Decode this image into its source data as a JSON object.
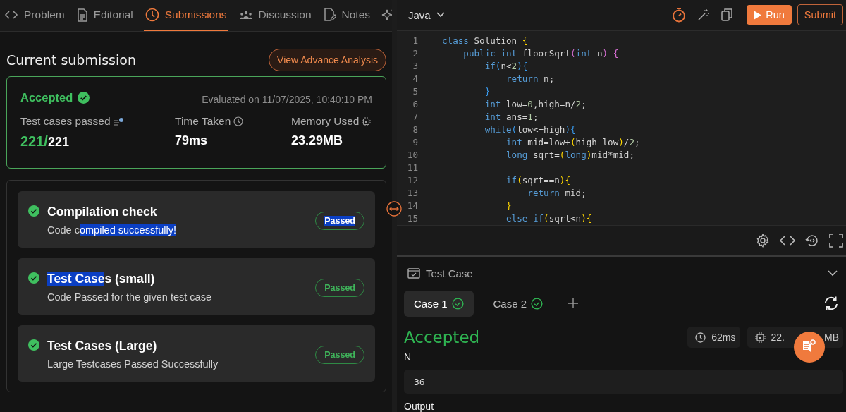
{
  "left_tabs": [
    {
      "label": "Problem",
      "selected": false
    },
    {
      "label": "Editorial",
      "selected": false
    },
    {
      "label": "Submissions",
      "selected": true
    },
    {
      "label": "Discussion",
      "selected": false
    },
    {
      "label": "Notes",
      "selected": false
    }
  ],
  "submission": {
    "heading": "Current submission",
    "analysis_button": "View Advance Analysis",
    "status": "Accepted",
    "evaluated": "Evaluated on 11/07/2025, 10:40:10 PM",
    "stats": [
      {
        "kind": "count",
        "label": "Test cases passed",
        "passed": "221/",
        "total": "221"
      },
      {
        "kind": "time",
        "label": "Time Taken",
        "value": "79ms"
      },
      {
        "kind": "memory",
        "label": "Memory Used",
        "value": "23.29MB"
      }
    ]
  },
  "checks": [
    {
      "passed": true,
      "title": [
        {
          "text": "Compilation check",
          "highlighted": false
        }
      ],
      "description": [
        {
          "text": "Code c",
          "highlighted": false
        },
        {
          "text": "ompiled successfully!",
          "highlighted": true
        }
      ],
      "badge": {
        "label": "Passed",
        "highlighted": true
      }
    },
    {
      "passed": true,
      "title": [
        {
          "text": "Test Case",
          "highlighted": true
        },
        {
          "text": "s (small)",
          "highlighted": false
        }
      ],
      "description": [
        {
          "text": "Code Passed for the given test case",
          "highlighted": false
        }
      ],
      "badge": {
        "label": "Passed",
        "highlighted": false
      }
    },
    {
      "passed": true,
      "title": [
        {
          "text": "Test Cases (Large)",
          "highlighted": false
        }
      ],
      "description": [
        {
          "text": "Large Testcases Passed Successfully",
          "highlighted": false
        }
      ],
      "badge": {
        "label": "Passed",
        "highlighted": false
      }
    }
  ],
  "editor": {
    "language": "Java",
    "run_button": "Run",
    "submit_button": "Submit",
    "lines": [
      {
        "number": "1",
        "tokens": [
          {
            "kind": "kw",
            "text": "class"
          },
          {
            "kind": "id",
            "text": " Solution "
          },
          {
            "kind": "br",
            "text": "{"
          }
        ]
      },
      {
        "number": "2",
        "tokens": [
          {
            "kind": "kw",
            "text": "    public int"
          },
          {
            "kind": "id",
            "text": " floorSqrt"
          },
          {
            "kind": "pa",
            "text": "("
          },
          {
            "kind": "kw",
            "text": "int"
          },
          {
            "kind": "id",
            "text": " n"
          },
          {
            "kind": "pa",
            "text": ") {"
          }
        ]
      },
      {
        "number": "3",
        "tokens": [
          {
            "kind": "kw",
            "text": "        if"
          },
          {
            "kind": "bl",
            "text": "("
          },
          {
            "kind": "id",
            "text": "n<"
          },
          {
            "kind": "num",
            "text": "2"
          },
          {
            "kind": "bl",
            "text": "){"
          }
        ]
      },
      {
        "number": "4",
        "tokens": [
          {
            "kind": "kw",
            "text": "            return"
          },
          {
            "kind": "id",
            "text": " n;"
          }
        ]
      },
      {
        "number": "5",
        "tokens": [
          {
            "kind": "bl",
            "text": "        }"
          }
        ]
      },
      {
        "number": "6",
        "tokens": [
          {
            "kind": "kw",
            "text": "        int"
          },
          {
            "kind": "id",
            "text": " low="
          },
          {
            "kind": "num",
            "text": "0"
          },
          {
            "kind": "id",
            "text": ",high=n/"
          },
          {
            "kind": "num",
            "text": "2"
          },
          {
            "kind": "id",
            "text": ";"
          }
        ]
      },
      {
        "number": "7",
        "tokens": [
          {
            "kind": "kw",
            "text": "        int"
          },
          {
            "kind": "id",
            "text": " ans="
          },
          {
            "kind": "num",
            "text": "1"
          },
          {
            "kind": "id",
            "text": ";"
          }
        ]
      },
      {
        "number": "8",
        "tokens": [
          {
            "kind": "kw",
            "text": "        while"
          },
          {
            "kind": "bl",
            "text": "("
          },
          {
            "kind": "id",
            "text": "low<=high"
          },
          {
            "kind": "bl",
            "text": "){"
          }
        ]
      },
      {
        "number": "9",
        "tokens": [
          {
            "kind": "kw",
            "text": "            int"
          },
          {
            "kind": "id",
            "text": " mid=low+"
          },
          {
            "kind": "br",
            "text": "("
          },
          {
            "kind": "id",
            "text": "high-low"
          },
          {
            "kind": "br",
            "text": ")"
          },
          {
            "kind": "id",
            "text": "/"
          },
          {
            "kind": "num",
            "text": "2"
          },
          {
            "kind": "id",
            "text": ";"
          }
        ]
      },
      {
        "number": "10",
        "tokens": [
          {
            "kind": "kw",
            "text": "            long"
          },
          {
            "kind": "id",
            "text": " sqrt="
          },
          {
            "kind": "br",
            "text": "("
          },
          {
            "kind": "kw",
            "text": "long"
          },
          {
            "kind": "br",
            "text": ")"
          },
          {
            "kind": "id",
            "text": "mid*mid;"
          }
        ]
      },
      {
        "number": "11"
      },
      {
        "number": "12",
        "tokens": [
          {
            "kind": "kw",
            "text": "            if"
          },
          {
            "kind": "br",
            "text": "("
          },
          {
            "kind": "id",
            "text": "sqrt==n"
          },
          {
            "kind": "br",
            "text": "){"
          }
        ]
      },
      {
        "number": "13",
        "tokens": [
          {
            "kind": "kw",
            "text": "                return"
          },
          {
            "kind": "id",
            "text": " mid;"
          }
        ]
      },
      {
        "number": "14",
        "tokens": [
          {
            "kind": "br",
            "text": "            }"
          }
        ]
      },
      {
        "number": "15",
        "tokens": [
          {
            "kind": "kw",
            "text": "            else if"
          },
          {
            "kind": "br",
            "text": "("
          },
          {
            "kind": "id",
            "text": "sqrt<n"
          },
          {
            "kind": "br",
            "text": "){"
          }
        ]
      }
    ]
  },
  "test_panel": {
    "title": "Test Case",
    "cases": [
      {
        "label": "Case 1",
        "passed": true,
        "selected": true
      },
      {
        "label": "Case 2",
        "passed": true,
        "selected": false
      }
    ],
    "result": "Accepted",
    "time": "62ms",
    "memory_start": "22.",
    "memory_end": "MB",
    "input_label": "N",
    "input_value": "36",
    "output_label": "Output"
  }
}
